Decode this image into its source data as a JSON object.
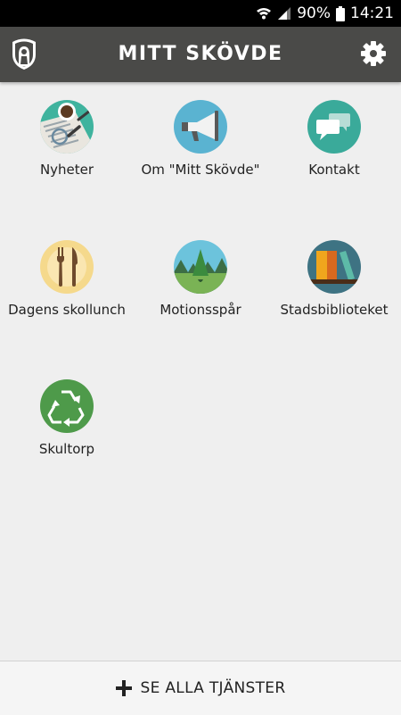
{
  "status_bar": {
    "battery": "90%",
    "time": "14:21",
    "icons": [
      "wifi-icon",
      "signal-icon",
      "battery-icon"
    ]
  },
  "app_bar": {
    "title": "MITT SKÖVDE",
    "left_icon": "city-crest-logo",
    "right_icon": "gear-icon",
    "background": "#4a4a48"
  },
  "services": [
    {
      "label": "Nyheter",
      "icon": "newspaper-icon"
    },
    {
      "label": "Om \"Mitt Skövde\"",
      "icon": "megaphone-icon"
    },
    {
      "label": "Kontakt",
      "icon": "chat-bubbles-icon"
    },
    {
      "label": "Dagens skollunch",
      "icon": "fork-knife-icon"
    },
    {
      "label": "Motionsspår",
      "icon": "forest-trail-icon"
    },
    {
      "label": "Stadsbiblioteket",
      "icon": "books-icon"
    },
    {
      "label": "Skultorp",
      "icon": "recycle-icon"
    }
  ],
  "bottom_bar": {
    "label": "SE ALLA TJÄNSTER",
    "icon": "plus-icon"
  },
  "colors": {
    "background": "#efefef",
    "app_bar": "#4a4a48",
    "teal": "#3aaa9a",
    "light_blue": "#5ab3d1",
    "green": "#4e9a4a"
  }
}
